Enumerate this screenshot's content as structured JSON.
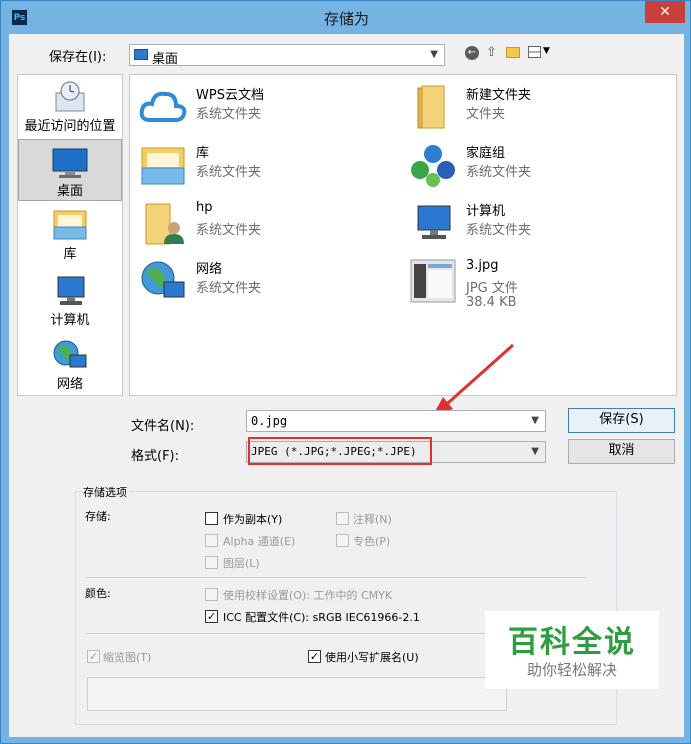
{
  "window": {
    "title": "存储为",
    "app_icon": "Ps",
    "close_glyph": "✕"
  },
  "save_in": {
    "label": "保存在(I):",
    "value": "桌面"
  },
  "places": [
    {
      "label": "最近访问的位置",
      "icon": "recent-places-icon"
    },
    {
      "label": "桌面",
      "icon": "desktop-icon"
    },
    {
      "label": "库",
      "icon": "library-icon"
    },
    {
      "label": "计算机",
      "icon": "computer-icon"
    },
    {
      "label": "网络",
      "icon": "network-icon"
    }
  ],
  "files": [
    {
      "name": "WPS云文档",
      "type": "系统文件夹",
      "icon": "cloud-icon"
    },
    {
      "name": "新建文件夹",
      "type": "文件夹",
      "icon": "folder-icon"
    },
    {
      "name": "库",
      "type": "系统文件夹",
      "icon": "library-icon"
    },
    {
      "name": "家庭组",
      "type": "系统文件夹",
      "icon": "homegroup-icon"
    },
    {
      "name": "hp",
      "type": "系统文件夹",
      "icon": "user-folder-icon"
    },
    {
      "name": "计算机",
      "type": "系统文件夹",
      "icon": "computer-icon"
    },
    {
      "name": "网络",
      "type": "系统文件夹",
      "icon": "network-icon"
    },
    {
      "name": "3.jpg",
      "type": "JPG 文件",
      "size": "38.4 KB",
      "icon": "image-thumbnail-icon"
    }
  ],
  "filename": {
    "label": "文件名(N):",
    "value": "0.jpg"
  },
  "format": {
    "label": "格式(F):",
    "value": "JPEG (*.JPG;*.JPEG;*.JPE)"
  },
  "buttons": {
    "save": "保存(S)",
    "cancel": "取消"
  },
  "options": {
    "group_title": "存储选项",
    "save_section": "存储:",
    "as_copy": "作为副本(Y)",
    "notes": "注释(N)",
    "alpha": "Alpha 通道(E)",
    "spot": "专色(P)",
    "layers": "图层(L)",
    "color_section": "颜色:",
    "proof": "使用校样设置(O):  工作中的 CMYK",
    "icc": "ICC 配置文件(C):  sRGB IEC61966-2.1",
    "thumbnail": "缩览图(T)",
    "lowercase_ext": "使用小写扩展名(U)"
  },
  "watermark": {
    "title": "百科全说",
    "subtitle": "助你轻松解决"
  },
  "colors": {
    "accent": "#3c7fb1",
    "highlight_box": "#e03030",
    "arrow": "#e03030",
    "title_bar": "#75b4e2",
    "watermark_green": "#2f9d3f"
  }
}
